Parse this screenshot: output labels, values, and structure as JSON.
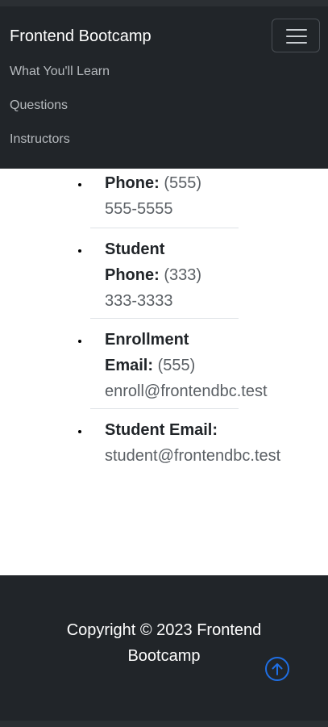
{
  "navbar": {
    "brand": "Frontend Bootcamp",
    "links": [
      "What You'll Learn",
      "Questions",
      "Instructors"
    ]
  },
  "contacts": [
    {
      "label_lines": [
        "Phone:"
      ],
      "value_lines": [
        " (555)",
        "555-5555"
      ]
    },
    {
      "label_lines": [
        "Student",
        "Phone:"
      ],
      "value_lines": [
        " (333)",
        "333-3333"
      ]
    },
    {
      "label_lines": [
        "Enrollment",
        "Email:"
      ],
      "value_lines": [
        " (555)",
        "enroll@frontendbc.test"
      ]
    },
    {
      "label_lines": [
        "Student Email:"
      ],
      "value_lines": [
        "student@frontendbc.test"
      ]
    }
  ],
  "footer": {
    "copyright": "Copyright © 2023 Frontend Bootcamp"
  },
  "colors": {
    "accent": "#1f6fe5",
    "dark": "#212529"
  },
  "icons": {
    "menu": "hamburger-icon",
    "scroll_top": "arrow-up-circle-icon"
  }
}
